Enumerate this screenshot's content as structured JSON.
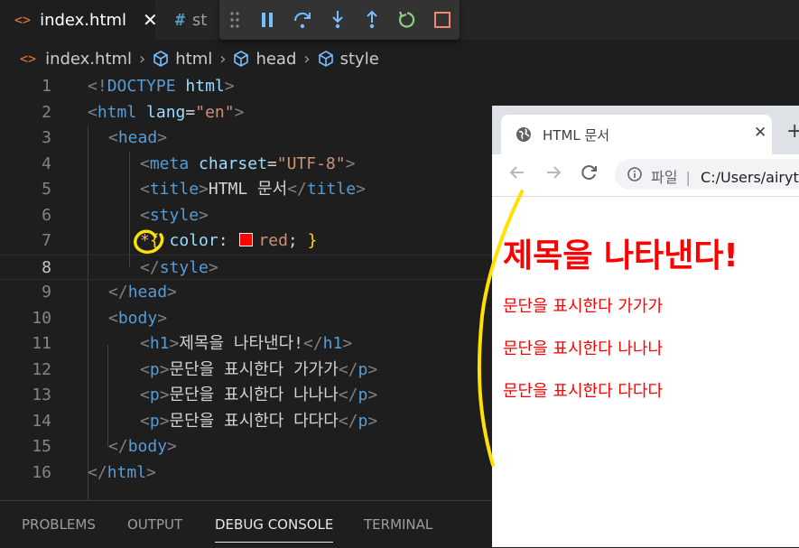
{
  "editor_tabs": {
    "active": {
      "icon": "<>",
      "label": "index.html",
      "close": "✕"
    },
    "inactive": {
      "icon": "#",
      "label": "st"
    }
  },
  "debug_toolbar": [
    "drag-handle",
    "pause",
    "step-over",
    "step-into",
    "step-out",
    "restart",
    "stop"
  ],
  "breadcrumb": {
    "file": "index.html",
    "items": [
      "html",
      "head",
      "style"
    ]
  },
  "code_lines": [
    {
      "n": "1",
      "indent": 0,
      "tokens": [
        [
          "brk",
          "<!"
        ],
        [
          "tag",
          "DOCTYPE"
        ],
        [
          "txt",
          " "
        ],
        [
          "attr",
          "html"
        ],
        [
          "brk",
          ">"
        ]
      ]
    },
    {
      "n": "2",
      "indent": 0,
      "tokens": [
        [
          "brk",
          "<"
        ],
        [
          "tag",
          "html"
        ],
        [
          "txt",
          " "
        ],
        [
          "attr",
          "lang"
        ],
        [
          "txt",
          "="
        ],
        [
          "str",
          "\"en\""
        ],
        [
          "brk",
          ">"
        ]
      ]
    },
    {
      "n": "3",
      "indent": 1,
      "tokens": [
        [
          "brk",
          "<"
        ],
        [
          "tag",
          "head"
        ],
        [
          "brk",
          ">"
        ]
      ]
    },
    {
      "n": "4",
      "indent": 2,
      "tokens": [
        [
          "brk",
          "<"
        ],
        [
          "tag",
          "meta"
        ],
        [
          "txt",
          " "
        ],
        [
          "attr",
          "charset"
        ],
        [
          "txt",
          "="
        ],
        [
          "str",
          "\"UTF-8\""
        ],
        [
          "brk",
          ">"
        ]
      ]
    },
    {
      "n": "5",
      "indent": 2,
      "tokens": [
        [
          "brk",
          "<"
        ],
        [
          "tag",
          "title"
        ],
        [
          "brk",
          ">"
        ],
        [
          "txt",
          "HTML 문서"
        ],
        [
          "brk",
          "</"
        ],
        [
          "tag",
          "title"
        ],
        [
          "brk",
          ">"
        ]
      ]
    },
    {
      "n": "6",
      "indent": 2,
      "tokens": [
        [
          "brk",
          "<"
        ],
        [
          "tag",
          "style"
        ],
        [
          "brk",
          ">"
        ]
      ]
    },
    {
      "n": "7",
      "indent": 2,
      "tokens": [
        [
          "sel",
          "*"
        ],
        [
          "brace",
          "{"
        ],
        [
          "txt",
          " "
        ],
        [
          "attr",
          "color"
        ],
        [
          "txt",
          ": "
        ],
        [
          "swatch",
          ""
        ],
        [
          "str",
          "red"
        ],
        [
          "txt",
          "; "
        ],
        [
          "brace",
          "}"
        ]
      ]
    },
    {
      "n": "8",
      "indent": 2,
      "current": true,
      "tokens": [
        [
          "brk",
          "</"
        ],
        [
          "tag",
          "style"
        ],
        [
          "brk",
          ">"
        ]
      ]
    },
    {
      "n": "9",
      "indent": 1,
      "tokens": [
        [
          "brk",
          "</"
        ],
        [
          "tag",
          "head"
        ],
        [
          "brk",
          ">"
        ]
      ]
    },
    {
      "n": "10",
      "indent": 1,
      "tokens": [
        [
          "brk",
          "<"
        ],
        [
          "tag",
          "body"
        ],
        [
          "brk",
          ">"
        ]
      ]
    },
    {
      "n": "11",
      "indent": 2,
      "tokens": [
        [
          "brk",
          "<"
        ],
        [
          "tag",
          "h1"
        ],
        [
          "brk",
          ">"
        ],
        [
          "txt",
          "제목을 나타낸다!"
        ],
        [
          "brk",
          "</"
        ],
        [
          "tag",
          "h1"
        ],
        [
          "brk",
          ">"
        ]
      ]
    },
    {
      "n": "12",
      "indent": 2,
      "tokens": [
        [
          "brk",
          "<"
        ],
        [
          "tag",
          "p"
        ],
        [
          "brk",
          ">"
        ],
        [
          "txt",
          "문단을 표시한다 가가가"
        ],
        [
          "brk",
          "</"
        ],
        [
          "tag",
          "p"
        ],
        [
          "brk",
          ">"
        ]
      ]
    },
    {
      "n": "13",
      "indent": 2,
      "tokens": [
        [
          "brk",
          "<"
        ],
        [
          "tag",
          "p"
        ],
        [
          "brk",
          ">"
        ],
        [
          "txt",
          "문단을 표시한다 나나나"
        ],
        [
          "brk",
          "</"
        ],
        [
          "tag",
          "p"
        ],
        [
          "brk",
          ">"
        ]
      ]
    },
    {
      "n": "14",
      "indent": 2,
      "tokens": [
        [
          "brk",
          "<"
        ],
        [
          "tag",
          "p"
        ],
        [
          "brk",
          ">"
        ],
        [
          "txt",
          "문단을 표시한다 다다다"
        ],
        [
          "brk",
          "</"
        ],
        [
          "tag",
          "p"
        ],
        [
          "brk",
          ">"
        ]
      ]
    },
    {
      "n": "15",
      "indent": 1,
      "tokens": [
        [
          "brk",
          "</"
        ],
        [
          "tag",
          "body"
        ],
        [
          "brk",
          ">"
        ]
      ]
    },
    {
      "n": "16",
      "indent": 0,
      "tokens": [
        [
          "brk",
          "</"
        ],
        [
          "tag",
          "html"
        ],
        [
          "brk",
          ">"
        ]
      ]
    }
  ],
  "panel_tabs": [
    {
      "label": "PROBLEMS",
      "active": false
    },
    {
      "label": "OUTPUT",
      "active": false
    },
    {
      "label": "DEBUG CONSOLE",
      "active": true
    },
    {
      "label": "TERMINAL",
      "active": false
    }
  ],
  "browser": {
    "tab_title": "HTML 문서",
    "tab_close": "✕",
    "new_tab": "+",
    "address_scheme_label": "파일",
    "address_separator": "|",
    "address_path": "C:/Users/airyt",
    "page": {
      "h1": "제목을 나타낸다!",
      "paragraphs": [
        "문단을 표시한다 가가가",
        "문단을 표시한다 나나나",
        "문단을 표시한다 다다다"
      ]
    }
  },
  "colors": {
    "editor_bg": "#1e1e1e",
    "accent_annotation": "#ffe100",
    "page_text": "#ff0000"
  }
}
